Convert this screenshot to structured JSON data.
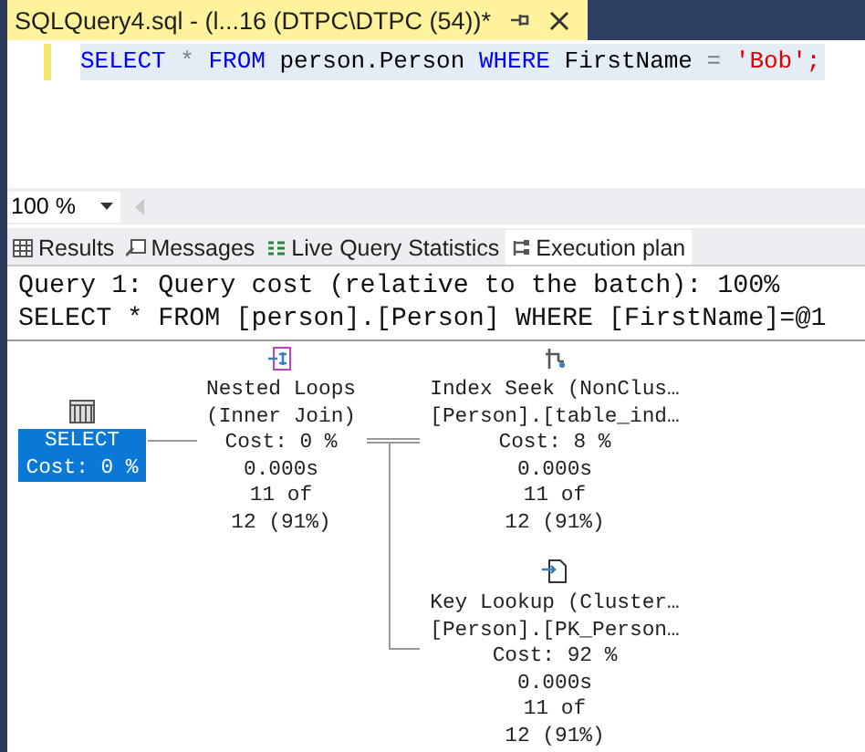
{
  "document_tab": {
    "title": "SQLQuery4.sql - (l...16 (DTPC\\DTPC (54))*"
  },
  "editor": {
    "tokens": [
      {
        "text": "SELECT",
        "kind": "keyword"
      },
      {
        "text": "*",
        "kind": "operator"
      },
      {
        "text": "FROM",
        "kind": "keyword"
      },
      {
        "text": "person.Person",
        "kind": "plain"
      },
      {
        "text": "WHERE",
        "kind": "keyword"
      },
      {
        "text": "FirstName",
        "kind": "plain"
      },
      {
        "text": "=",
        "kind": "operator"
      },
      {
        "text": "'Bob';",
        "kind": "string"
      }
    ]
  },
  "zoom": {
    "value": "100 %"
  },
  "result_tabs": [
    {
      "label": "Results",
      "kind": "grid",
      "selected": false
    },
    {
      "label": "Messages",
      "kind": "messages",
      "selected": false
    },
    {
      "label": "Live Query Statistics",
      "kind": "live",
      "selected": false
    },
    {
      "label": "Execution plan",
      "kind": "plan",
      "selected": true
    }
  ],
  "plan": {
    "header": [
      "Query 1: Query cost (relative to the batch): 100%",
      "SELECT * FROM [person].[Person] WHERE [FirstName]=@1"
    ],
    "nodes": [
      {
        "kind": "select",
        "selected": true,
        "lines": [
          "SELECT",
          "Cost: 0 %"
        ]
      },
      {
        "kind": "nested_loops",
        "selected": false,
        "lines": [
          "Nested Loops",
          "(Inner Join)",
          "Cost: 0 %",
          "0.000s",
          "11 of",
          "12 (91%)"
        ]
      },
      {
        "kind": "index_seek",
        "selected": false,
        "lines": [
          "Index Seek (NonClus…",
          "[Person].[table_ind…",
          "Cost: 8 %",
          "0.000s",
          "11 of",
          "12 (91%)"
        ]
      },
      {
        "kind": "key_lookup",
        "selected": false,
        "lines": [
          "Key Lookup (Cluster…",
          "[Person].[PK_Person…",
          "Cost: 92 %",
          "0.000s",
          "11 of",
          "12 (91%)"
        ]
      }
    ]
  }
}
